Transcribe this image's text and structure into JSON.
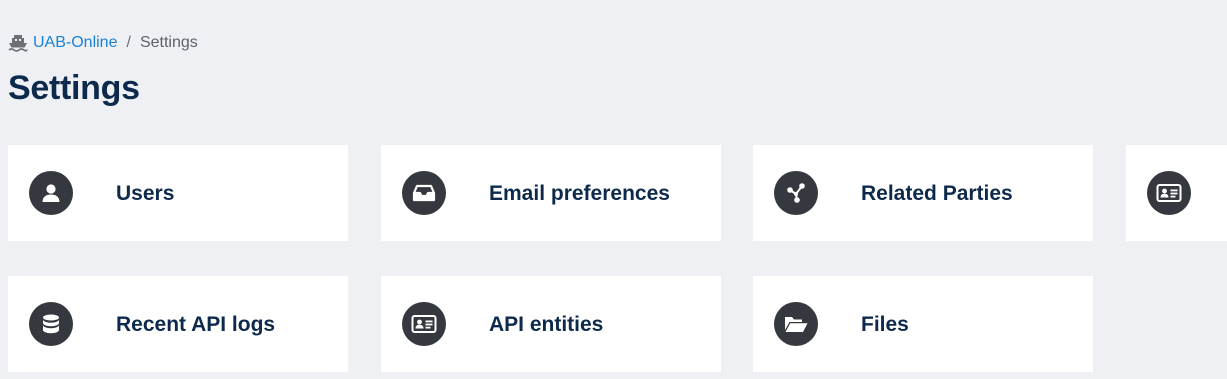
{
  "breadcrumb": {
    "icon": "ship-icon",
    "home_label": "UAB-Online",
    "separator": "/",
    "current_label": "Settings"
  },
  "page": {
    "title": "Settings"
  },
  "colors": {
    "background": "#eff0f4",
    "card": "#ffffff",
    "icon_circle": "#35383e",
    "title_text": "#0d2a4d",
    "link": "#1a82d6"
  },
  "cards": [
    {
      "label": "Users",
      "icon": "user-icon"
    },
    {
      "label": "Email preferences",
      "icon": "inbox-icon"
    },
    {
      "label": "Related Parties",
      "icon": "network-icon"
    },
    {
      "label": "",
      "icon": "id-card-icon"
    },
    {
      "label": "Recent API logs",
      "icon": "database-icon"
    },
    {
      "label": "API entities",
      "icon": "id-card-icon"
    },
    {
      "label": "Files",
      "icon": "folder-open-icon"
    }
  ]
}
